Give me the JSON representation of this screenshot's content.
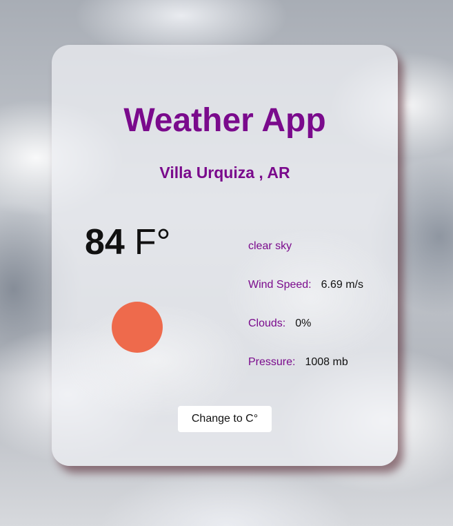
{
  "app": {
    "title": "Weather App"
  },
  "location": {
    "label": "Villa Urquiza , AR"
  },
  "current": {
    "temperature": "84",
    "unit": "F°",
    "icon": "sun-icon",
    "description": "clear sky"
  },
  "details": [
    {
      "label": "Wind Speed:",
      "value": "6.69 m/s"
    },
    {
      "label": "Clouds:",
      "value": "0%"
    },
    {
      "label": "Pressure:",
      "value": "1008 mb"
    }
  ],
  "actions": {
    "toggle_unit_label": "Change to C°"
  },
  "colors": {
    "accent": "#7a0a8c",
    "sun": "#ee6a4c"
  }
}
